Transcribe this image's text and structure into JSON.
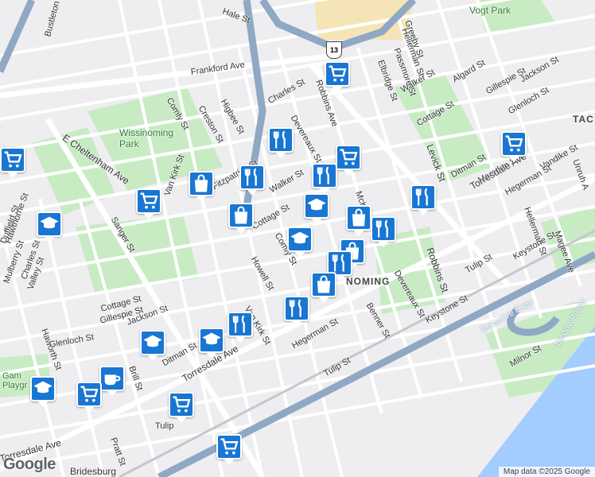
{
  "map": {
    "place_labels": {
      "vogt_park": "Vogt Park",
      "wissinoming_park": "Wissinoming\nPark",
      "wissinoming": "NOMING",
      "tacony": "TAC",
      "bridesburg": "Bridesburg",
      "gam_playground": "Gam\nPlaygr"
    },
    "street_labels": [
      "Frankford Ave",
      "Bustleton",
      "Hale St",
      "Comly St",
      "Creston St",
      "Higbee St",
      "Charles St",
      "Devereaux St",
      "Robbins Ave",
      "Elbridge St",
      "Passmore St",
      "Hellerman St",
      "Greeby St",
      "Walker St",
      "Algard St",
      "Gillespie St",
      "Jackson St",
      "Glenloch St",
      "Cottage St",
      "Levick St",
      "Ditman St",
      "Marsden St",
      "Torresdale Ave",
      "Vandike St",
      "Unruh A",
      "Hegerman St",
      "Hellerman St",
      "Magee Ave",
      "Keystone St",
      "Tulip St",
      "Robbins St",
      "E Cheltenham Ave",
      "Van Kirk St",
      "Sanger St",
      "Charles St",
      "Valley St",
      "Duffield St",
      "Mulberry St",
      "Hawthorne St",
      "Haworth St",
      "Glenloch St",
      "Jackson St",
      "Gillespie St",
      "Cottage St",
      "Howell St",
      "Comly St",
      "Benner St",
      "Devereaux St",
      "Keystone St",
      "Hegerman St",
      "Tulip St",
      "Milnor St",
      "Delaware Expy",
      "Tacony-Palmy",
      "Torresdale Ave",
      "Pratt St",
      "Brill St",
      "Ditman St",
      "Van Kirk St",
      "Torresdale Ave",
      "Tulip",
      "Cottage St",
      "Vandike St",
      "Walker St",
      "Fitzpatrick St",
      "McKinley",
      "Mc Neill St"
    ],
    "shield": "13",
    "attribution": "Map data ©2025 Google",
    "google_logo": "Google"
  },
  "colors": {
    "pin_blue": "#1976d2",
    "park_green": "#c8ebc4",
    "water_blue": "#a3ccff",
    "highway_blue": "#8fa8c4",
    "road_gray": "#ffffff"
  },
  "pins": [
    {
      "icon": "cart-icon"
    },
    {
      "icon": "cart-icon"
    },
    {
      "icon": "fork-knife-icon"
    },
    {
      "icon": "bag-icon"
    },
    {
      "icon": "fork-knife-icon"
    },
    {
      "icon": "cart-icon"
    },
    {
      "icon": "bag-icon"
    },
    {
      "icon": "cart-icon"
    },
    {
      "icon": "fork-knife-icon"
    },
    {
      "icon": "school-icon"
    },
    {
      "icon": "bag-icon"
    },
    {
      "icon": "fork-knife-icon"
    },
    {
      "icon": "fork-knife-icon"
    },
    {
      "icon": "school-icon"
    },
    {
      "icon": "bag-icon"
    },
    {
      "icon": "fork-knife-icon"
    },
    {
      "icon": "bag-icon"
    },
    {
      "icon": "fork-knife-icon"
    },
    {
      "icon": "fork-knife-icon"
    },
    {
      "icon": "school-icon"
    },
    {
      "icon": "cafe-icon"
    },
    {
      "icon": "school-icon"
    },
    {
      "icon": "cart-icon"
    },
    {
      "icon": "cart-icon"
    },
    {
      "icon": "cart-icon"
    },
    {
      "icon": "school-icon"
    },
    {
      "icon": "school-icon"
    },
    {
      "icon": "cart-icon"
    }
  ]
}
